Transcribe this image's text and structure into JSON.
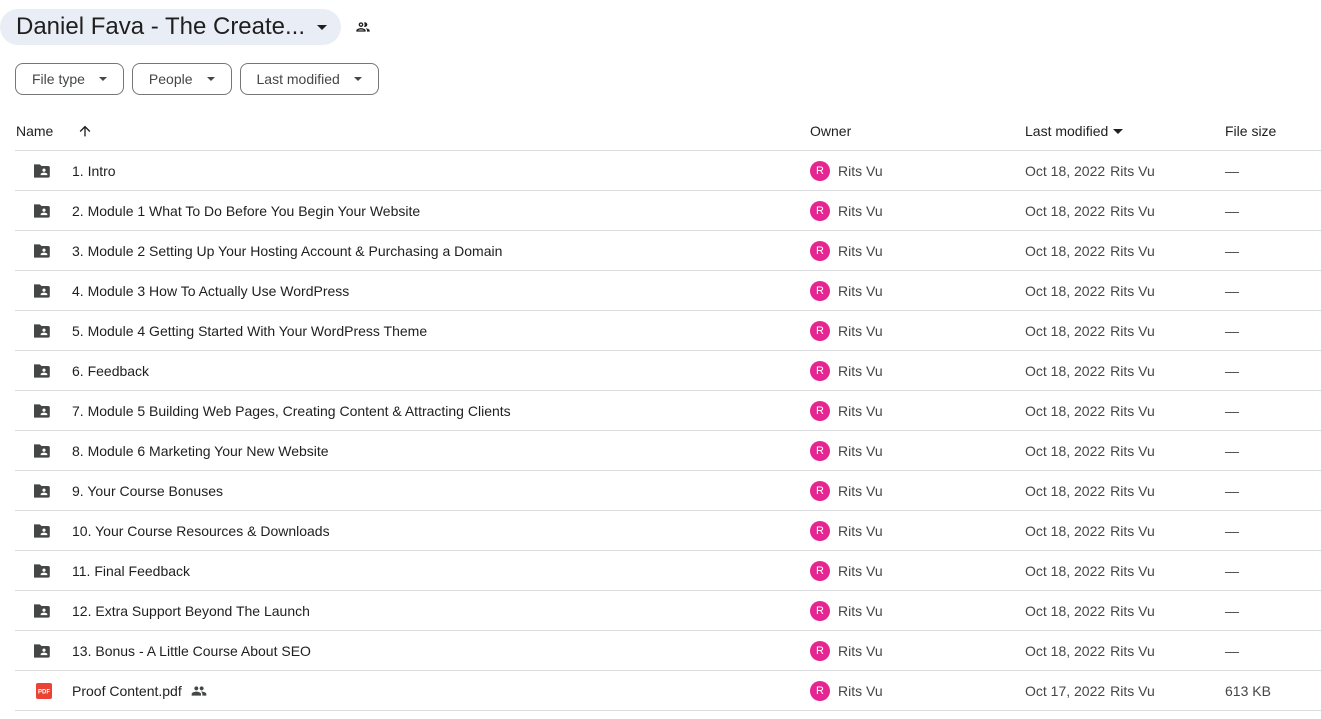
{
  "header": {
    "title": "Daniel Fava - The Create...",
    "title_caret_icon": "arrow-drop-down-icon",
    "shared_icon": "people-icon"
  },
  "filters": [
    {
      "label": "File type"
    },
    {
      "label": "People"
    },
    {
      "label": "Last modified"
    }
  ],
  "columns": {
    "name": "Name",
    "owner": "Owner",
    "last_modified": "Last modified",
    "file_size": "File size",
    "sort_direction_icon": "arrow-upward-icon"
  },
  "colors": {
    "avatar": "#e52592",
    "chip_bg": "#e9eef6",
    "folder_icon": "#444746",
    "pdf_icon": "#ea4335"
  },
  "rows": [
    {
      "type": "folder",
      "name": "1. Intro",
      "owner_initial": "R",
      "owner": "Rits Vu",
      "date": "Oct 18, 2022",
      "modified_by": "Rits Vu",
      "size": "—"
    },
    {
      "type": "folder",
      "name": "2. Module 1 What To Do Before You Begin Your Website",
      "owner_initial": "R",
      "owner": "Rits Vu",
      "date": "Oct 18, 2022",
      "modified_by": "Rits Vu",
      "size": "—"
    },
    {
      "type": "folder",
      "name": "3. Module 2 Setting Up Your Hosting Account & Purchasing a Domain",
      "owner_initial": "R",
      "owner": "Rits Vu",
      "date": "Oct 18, 2022",
      "modified_by": "Rits Vu",
      "size": "—"
    },
    {
      "type": "folder",
      "name": "4. Module 3 How To Actually Use WordPress",
      "owner_initial": "R",
      "owner": "Rits Vu",
      "date": "Oct 18, 2022",
      "modified_by": "Rits Vu",
      "size": "—"
    },
    {
      "type": "folder",
      "name": "5. Module 4 Getting Started With Your WordPress Theme",
      "owner_initial": "R",
      "owner": "Rits Vu",
      "date": "Oct 18, 2022",
      "modified_by": "Rits Vu",
      "size": "—"
    },
    {
      "type": "folder",
      "name": "6. Feedback",
      "owner_initial": "R",
      "owner": "Rits Vu",
      "date": "Oct 18, 2022",
      "modified_by": "Rits Vu",
      "size": "—"
    },
    {
      "type": "folder",
      "name": "7. Module 5 Building Web Pages, Creating Content & Attracting Clients",
      "owner_initial": "R",
      "owner": "Rits Vu",
      "date": "Oct 18, 2022",
      "modified_by": "Rits Vu",
      "size": "—"
    },
    {
      "type": "folder",
      "name": "8. Module 6 Marketing Your New Website",
      "owner_initial": "R",
      "owner": "Rits Vu",
      "date": "Oct 18, 2022",
      "modified_by": "Rits Vu",
      "size": "—"
    },
    {
      "type": "folder",
      "name": "9. Your Course Bonuses",
      "owner_initial": "R",
      "owner": "Rits Vu",
      "date": "Oct 18, 2022",
      "modified_by": "Rits Vu",
      "size": "—"
    },
    {
      "type": "folder",
      "name": "10. Your Course Resources & Downloads",
      "owner_initial": "R",
      "owner": "Rits Vu",
      "date": "Oct 18, 2022",
      "modified_by": "Rits Vu",
      "size": "—"
    },
    {
      "type": "folder",
      "name": "11. Final Feedback",
      "owner_initial": "R",
      "owner": "Rits Vu",
      "date": "Oct 18, 2022",
      "modified_by": "Rits Vu",
      "size": "—"
    },
    {
      "type": "folder",
      "name": "12. Extra Support Beyond The Launch",
      "owner_initial": "R",
      "owner": "Rits Vu",
      "date": "Oct 18, 2022",
      "modified_by": "Rits Vu",
      "size": "—"
    },
    {
      "type": "folder",
      "name": "13. Bonus - A Little Course About SEO",
      "owner_initial": "R",
      "owner": "Rits Vu",
      "date": "Oct 18, 2022",
      "modified_by": "Rits Vu",
      "size": "—"
    },
    {
      "type": "pdf",
      "name": "Proof Content.pdf",
      "shared": true,
      "owner_initial": "R",
      "owner": "Rits Vu",
      "date": "Oct 17, 2022",
      "modified_by": "Rits Vu",
      "size": "613 KB"
    }
  ]
}
